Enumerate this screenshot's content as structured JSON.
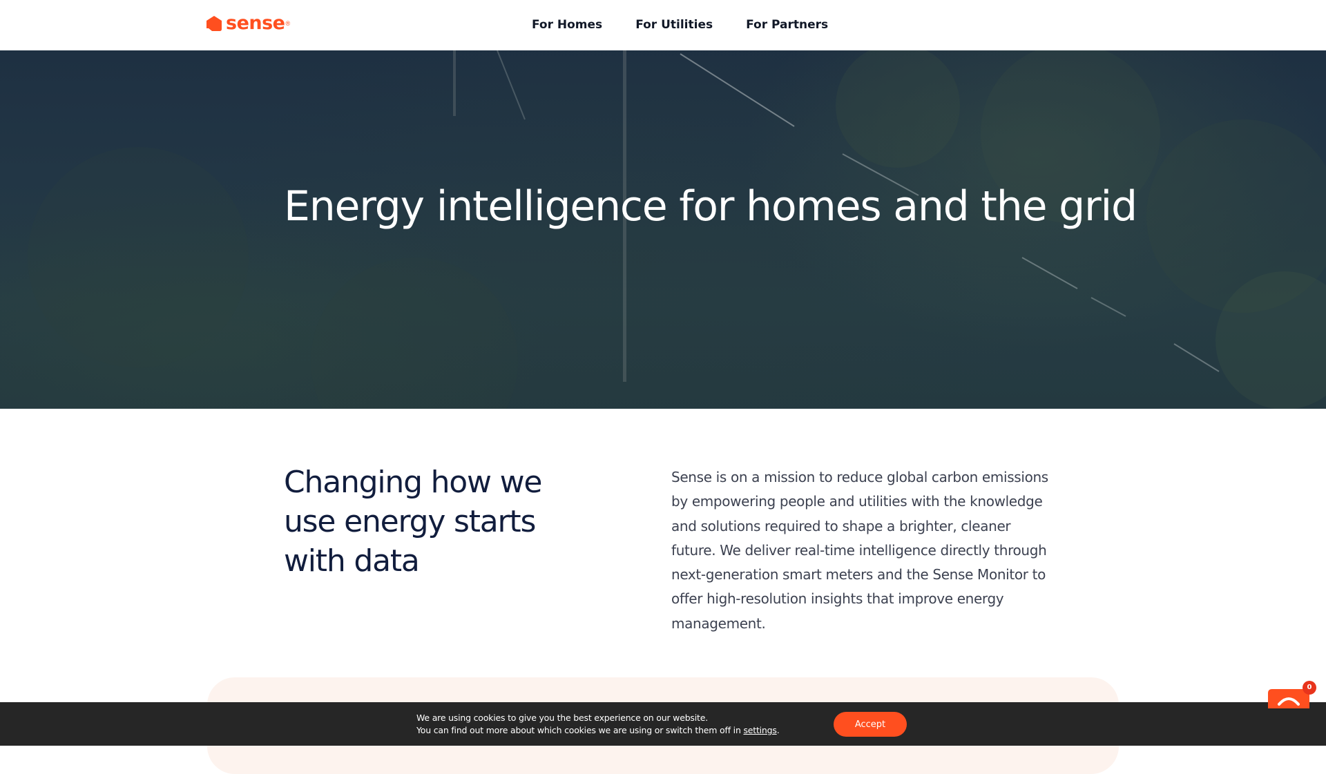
{
  "header": {
    "logo_text": "sense",
    "logo_reg": "®",
    "brand_color": "#ff4f1f",
    "nav": [
      {
        "label": "For Homes"
      },
      {
        "label": "For Utilities"
      },
      {
        "label": "For Partners"
      }
    ]
  },
  "hero": {
    "title": "Energy intelligence for homes and the grid"
  },
  "mission": {
    "heading": "Changing how we use energy starts with data",
    "body": "Sense is on a mission to reduce global carbon emissions by empowering people and utilities with the knowledge and solutions required to shape a brighter, cleaner future. We deliver real-time intelligence directly through next-generation smart meters and the Sense Monitor to offer high-resolution insights that improve energy management."
  },
  "cookie_bar": {
    "line1": "We are using cookies to give you the best experience on our website.",
    "line2_prefix": "You can find out more about which cookies we are using or switch them off in ",
    "settings_link": "settings",
    "line2_suffix": ".",
    "accept_label": "Accept"
  },
  "chat_widget": {
    "icon": "chat-bubble-icon",
    "badge_count": "0"
  }
}
